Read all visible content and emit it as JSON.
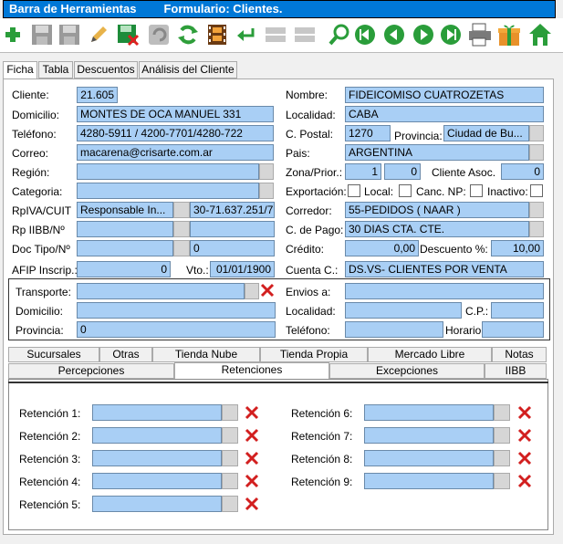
{
  "window": {
    "title_left": "Barra de Herramientas",
    "title_right": "Formulario: Clientes."
  },
  "toolbar": [
    "add-icon",
    "save-icon",
    "save-all-icon",
    "edit-icon",
    "delete-save-icon",
    "undo-icon",
    "refresh-icon",
    "film-icon",
    "return-icon",
    "grid-icon",
    "grid2-icon",
    "search-icon",
    "first-icon",
    "prev-icon",
    "next-icon",
    "last-icon",
    "print-icon",
    "gift-icon",
    "home-icon"
  ],
  "tabs": [
    "Ficha",
    "Tabla",
    "Descuentos",
    "Análisis del Cliente"
  ],
  "form": {
    "cliente_label": "Cliente:",
    "cliente": "21.605",
    "nombre_label": "Nombre:",
    "nombre": "FIDEICOMISO CUATROZETAS",
    "domicilio_label": "Domicilio:",
    "domicilio": "MONTES DE OCA MANUEL 331",
    "localidad_label": "Localidad:",
    "localidad": "CABA",
    "telefono_label": "Teléfono:",
    "telefono": "4280-5911 / 4200-7701/4280-722",
    "cpostal_label": "C. Postal:",
    "cpostal": "1270",
    "provincia_label": "Provincia:",
    "provincia": "Ciudad de Bu...",
    "correo_label": "Correo:",
    "correo": "macarena@crisarte.com.ar",
    "pais_label": "Pais:",
    "pais": "ARGENTINA",
    "region_label": "Región:",
    "zona_label": "Zona/Prior.:",
    "zona": "1",
    "prior": "0",
    "cliente_asoc_label": "Cliente Asoc.",
    "cliente_asoc": "0",
    "categoria_label": "Categoria:",
    "exportacion_label": "Exportación:",
    "local_label": "Local:",
    "canc_label": "Canc. NP:",
    "inactivo_label": "Inactivo:",
    "rpiva_label": "RpIVA/CUIT",
    "rpiva": "Responsable In...",
    "cuit": "30-71.637.251/7",
    "corredor_label": "Corredor:",
    "corredor": "55-PEDIDOS ( NAAR )",
    "rpiibb_label": "Rp IIBB/Nº",
    "cpago_label": "C. de Pago:",
    "cpago": "30 DIAS CTA. CTE.",
    "doc_label": "Doc Tipo/Nº",
    "doc_num": "0",
    "credito_label": "Crédito:",
    "credito": "0,00",
    "descuento_label": "Descuento %:",
    "descuento": "10,00",
    "afip_label": "AFIP Inscrip.:",
    "afip": "0",
    "vto_label": "Vto.:",
    "vto": "01/01/1900",
    "cuentac_label": "Cuenta C.:",
    "cuentac": "DS.VS- CLIENTES POR VENTA"
  },
  "transport": {
    "transporte_label": "Transporte:",
    "envios_label": "Envios a:",
    "domicilio_label": "Domicilio:",
    "localidad_label": "Localidad:",
    "cp_label": "C.P.:",
    "provincia_label": "Provincia:",
    "provincia": "0",
    "telefono_label": "Teléfono:",
    "horario_label": "Horario"
  },
  "subtabs_row1": [
    "Sucursales",
    "Otras",
    "Tienda Nube",
    "Tienda Propia",
    "Mercado Libre",
    "Notas"
  ],
  "subtabs_row2": [
    "Percepciones",
    "Retenciones",
    "Excepciones",
    "IIBB"
  ],
  "retenciones_left": [
    "Retención 1:",
    "Retención 2:",
    "Retención 3:",
    "Retención 4:",
    "Retención 5:"
  ],
  "retenciones_right": [
    "Retención 6:",
    "Retención 7:",
    "Retención 8:",
    "Retención 9:"
  ]
}
